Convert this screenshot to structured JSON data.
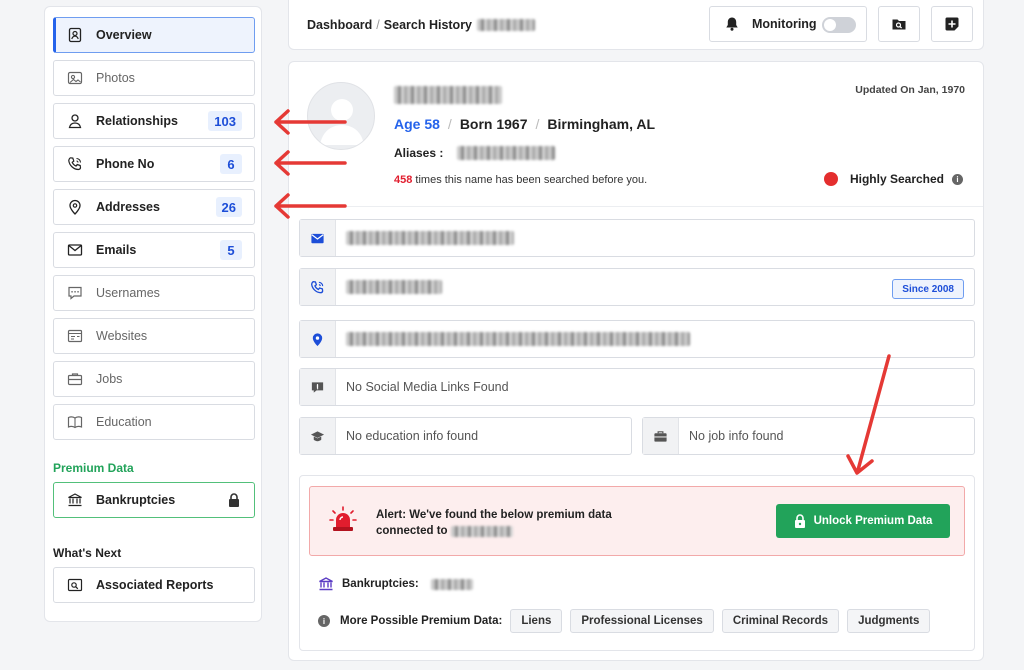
{
  "sidebar": {
    "items": [
      {
        "label": "Overview",
        "icon": "profile-card-icon"
      },
      {
        "label": "Photos",
        "icon": "photo-icon"
      },
      {
        "label": "Relationships",
        "icon": "user-icon",
        "count": "103"
      },
      {
        "label": "Phone No",
        "icon": "phone-icon",
        "count": "6"
      },
      {
        "label": "Addresses",
        "icon": "location-pin-icon",
        "count": "26"
      },
      {
        "label": "Emails",
        "icon": "envelope-icon",
        "count": "5"
      },
      {
        "label": "Usernames",
        "icon": "chat-icon"
      },
      {
        "label": "Websites",
        "icon": "browser-icon"
      },
      {
        "label": "Jobs",
        "icon": "briefcase-icon"
      },
      {
        "label": "Education",
        "icon": "book-icon"
      }
    ],
    "premium_title": "Premium Data",
    "premium_item": {
      "label": "Bankruptcies",
      "icon": "bank-icon"
    },
    "next_title": "What's Next",
    "next_item": {
      "label": "Associated Reports",
      "icon": "report-search-icon"
    }
  },
  "topbar": {
    "crumb_1": "Dashboard",
    "crumb_sep": "/",
    "crumb_2": "Search History",
    "monitoring_label": "Monitoring"
  },
  "profile": {
    "updated": "Updated On Jan, 1970",
    "age": "Age 58",
    "born": "Born 1967",
    "location": "Birmingham, AL",
    "aliases_label": "Aliases :",
    "search_count": "458",
    "search_text": " times this name has been searched before you.",
    "highly_searched": "Highly Searched"
  },
  "details": {
    "phone_since": "Since 2008",
    "social_empty": "No Social Media Links Found",
    "education_empty": "No education info found",
    "job_empty": "No job info found"
  },
  "premium": {
    "alert_line1": "Alert: We've found the below premium data",
    "alert_line2": "connected to",
    "unlock_label": "Unlock Premium Data",
    "bankruptcies_label": "Bankruptcies:",
    "more_label": "More Possible Premium Data:",
    "tags": [
      "Liens",
      "Professional Licenses",
      "Criminal Records",
      "Judgments"
    ]
  },
  "colors": {
    "accent": "#2563eb",
    "success": "#22a35a",
    "alert": "#e11d2e"
  }
}
